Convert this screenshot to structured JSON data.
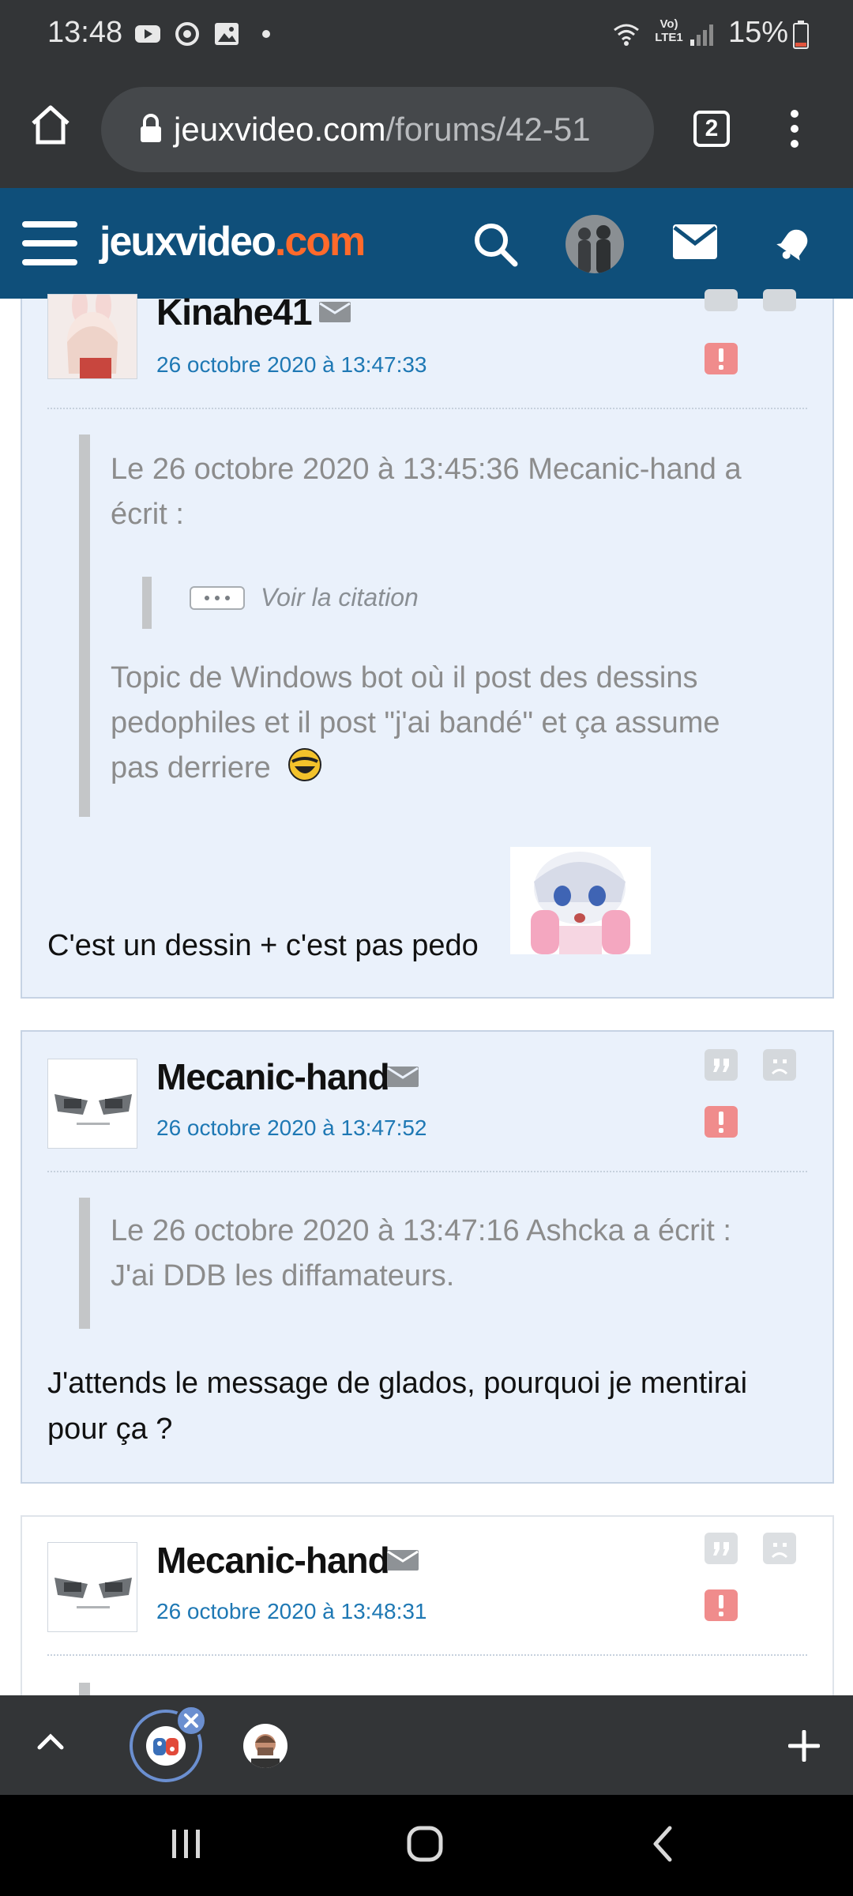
{
  "status_bar": {
    "time": "13:48",
    "battery": "15%",
    "network": "Vo) LTE1"
  },
  "browser": {
    "url_domain": "jeuxvideo.com",
    "url_path": "/forums/42-51",
    "tab_count": "2"
  },
  "site": {
    "logo_main": "jeuxvideo",
    "logo_tld": ".com",
    "brand_color": "#0f4f7a",
    "accent_color": "#ff6a2b"
  },
  "posts": [
    {
      "author": "Kinahe41",
      "date": "26 octobre 2020 à 13:47:33",
      "quote_header": "Le 26 octobre 2020 à 13:45:36 Mecanic-hand a écrit :",
      "quote_header_line1": "Le 26 octobre 2020 à 13:45:36 Mecanic-hand a",
      "quote_header_line2": "écrit :",
      "nested_quote_label": "Voir la citation",
      "quote_body_line1": "Topic de Windows bot où il post des dessins",
      "quote_body_line2": "pedophiles et il post \"j'ai bandé\" et ça assume",
      "quote_body_line3": "pas derriere",
      "body": "C'est un dessin + c'est pas pedo"
    },
    {
      "author": "Mecanic-hand",
      "date": "26 octobre 2020 à 13:47:52",
      "quote_line1": "Le 26 octobre 2020 à 13:47:16 Ashcka a écrit :",
      "quote_line2": "J'ai DDB les diffamateurs.",
      "body_line1": "J'attends le message de glados, pourquoi je mentirai",
      "body_line2": "pour ça ?"
    },
    {
      "author": "Mecanic-hand",
      "date": "26 octobre 2020 à 13:48:31"
    }
  ],
  "icons": {
    "home": "home-icon",
    "lock": "lock-icon",
    "menu": "overflow-menu-icon",
    "hamburger": "hamburger-icon",
    "search": "search-icon",
    "messages": "mail-icon",
    "notifications": "bell-icon",
    "quote": "quote-icon",
    "blacklist": "blacklist-icon",
    "report": "report-icon"
  }
}
